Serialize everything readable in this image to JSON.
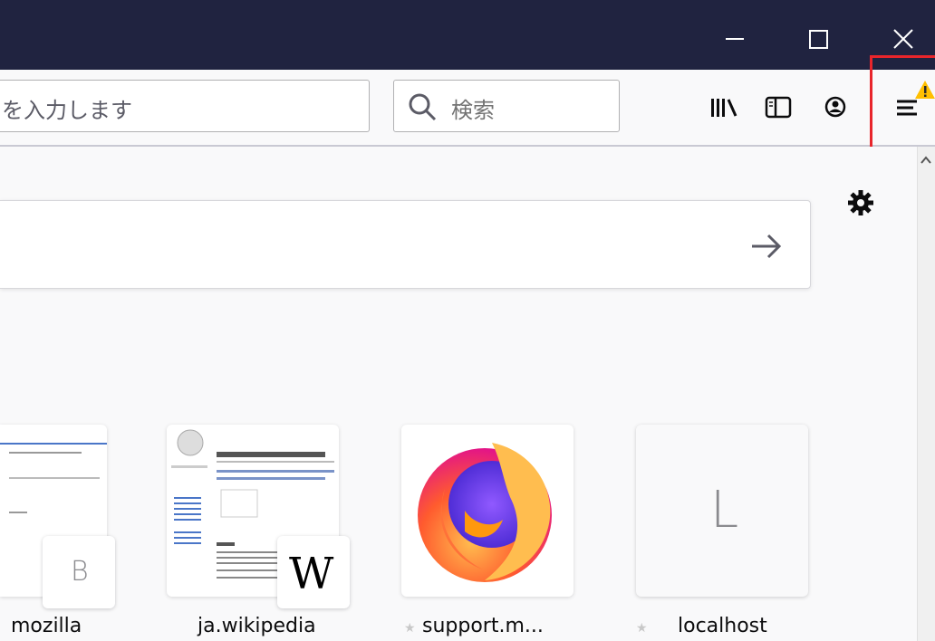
{
  "urlbar": {
    "value": "を入力します"
  },
  "searchbar": {
    "placeholder": "検索"
  },
  "toolbar": {
    "icons": [
      "library-icon",
      "sidebar-icon",
      "account-icon",
      "menu-icon",
      "warning-icon"
    ]
  },
  "window": {
    "controls": [
      "minimize-icon",
      "maximize-icon",
      "close-icon"
    ]
  },
  "newtab": {
    "tiles": [
      {
        "label": "mozilla",
        "letter": "B",
        "pinned": false
      },
      {
        "label": "ja.wikipedia",
        "letter": "W",
        "pinned": false
      },
      {
        "label": "support.m...",
        "letter": "",
        "pinned": true
      },
      {
        "label": "localhost",
        "letter": "L",
        "pinned": true
      }
    ]
  },
  "colors": {
    "titlebar": "#202340",
    "highlight": "#e8252b",
    "warning": "#ffbf00"
  }
}
